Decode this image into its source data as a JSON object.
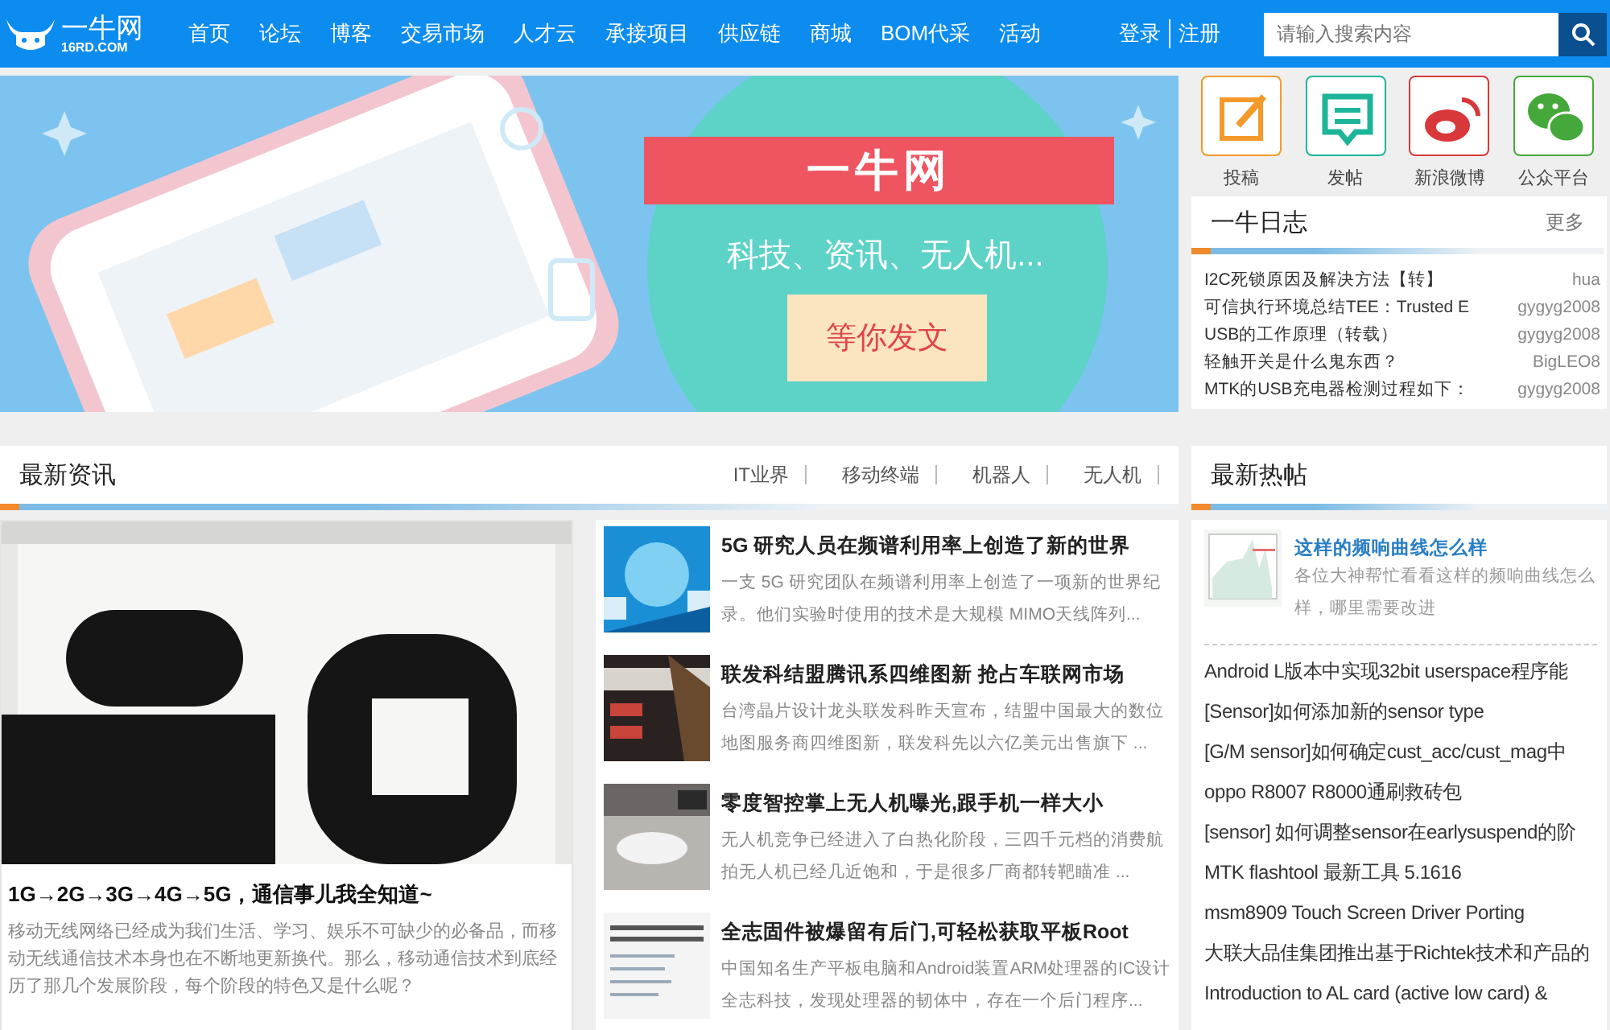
{
  "header": {
    "logo_text": "一牛网",
    "logo_sub": "16RD.COM",
    "nav": [
      "首页",
      "论坛",
      "博客",
      "交易市场",
      "人才云",
      "承接项目",
      "供应链",
      "商城",
      "BOM代采",
      "活动"
    ],
    "login": "登录",
    "register": "注册",
    "search": {
      "placeholder": "请输入搜索内容"
    }
  },
  "banner": {
    "title": "一牛网",
    "subtitle": "科技、资讯、无人机...",
    "button": "等你发文"
  },
  "shortcuts": [
    {
      "label": "投稿",
      "kind": "edit",
      "color": "#f39a2b"
    },
    {
      "label": "发帖",
      "kind": "message",
      "color": "#1cb59a"
    },
    {
      "label": "新浪微博",
      "kind": "weibo",
      "color": "#d9383a"
    },
    {
      "label": "公众平台",
      "kind": "wechat",
      "color": "#44a83a"
    }
  ],
  "diary": {
    "title": "一牛日志",
    "more": "更多",
    "items": [
      {
        "title": "I2C死锁原因及解决方法【转】",
        "author": "hua"
      },
      {
        "title": "可信执行环境总结TEE：Trusted E",
        "author": "gygyg2008"
      },
      {
        "title": "USB的工作原理（转载）",
        "author": "gygyg2008"
      },
      {
        "title": "轻触开关是什么鬼东西？",
        "author": "BigLEO8"
      },
      {
        "title": "MTK的USB充电器检测过程如下：",
        "author": "gygyg2008"
      }
    ]
  },
  "news": {
    "title": "最新资讯",
    "tabs": [
      "IT业界",
      "移动终端",
      "机器人",
      "无人机"
    ],
    "featured": {
      "title": "1G→2G→3G→4G→5G，通信事儿我全知道~",
      "summary": "移动无线网络已经成为我们生活、学习、娱乐不可缺少的必备品，而移动无线通信技术本身也在不断地更新换代。那么，移动通信技术到底经历了那几个发展阶段，每个阶段的特色又是什么呢？"
    },
    "items": [
      {
        "title": "5G 研究人员在频谱利用率上创造了新的世界",
        "summary": "一支 5G 研究团队在频谱利用率上创造了一项新的世界纪录。他们实验时使用的技术是大规模 MIMO天线阵列..."
      },
      {
        "title": "联发科结盟腾讯系四维图新 抢占车联网市场",
        "summary": "台湾晶片设计龙头联发科昨天宣布，结盟中国最大的数位地图服务商四维图新，联发科先以六亿美元出售旗下 ..."
      },
      {
        "title": "零度智控掌上无人机曝光,跟手机一样大小",
        "summary": "无人机竞争已经进入了白热化阶段，三四千元档的消费航拍无人机已经几近饱和，于是很多厂商都转靶瞄准 ..."
      },
      {
        "title": "全志固件被爆留有后门,可轻松获取平板Root",
        "summary": "中国知名生产平板电脑和Android装置ARM处理器的IC设计全志科技，发现处理器的韧体中，存在一个后门程序..."
      }
    ]
  },
  "hot": {
    "title": "最新热帖",
    "featured": {
      "title": "这样的频响曲线怎么样",
      "summary": "各位大神帮忙看看这样的频响曲线怎么样，哪里需要改进"
    },
    "items": [
      "Android L版本中实现32bit userspace程序能",
      "[Sensor]如何添加新的sensor type",
      "[G/M sensor]如何确定cust_acc/cust_mag中",
      "oppo R8007 R8000通刷救砖包",
      "[sensor] 如何调整sensor在earlysuspend的阶",
      "MTK flashtool 最新工具 5.1616",
      "msm8909 Touch Screen Driver Porting",
      "大联大品佳集团推出基于Richtek技术和产品的",
      "Introduction to AL card (active low card) &"
    ]
  }
}
